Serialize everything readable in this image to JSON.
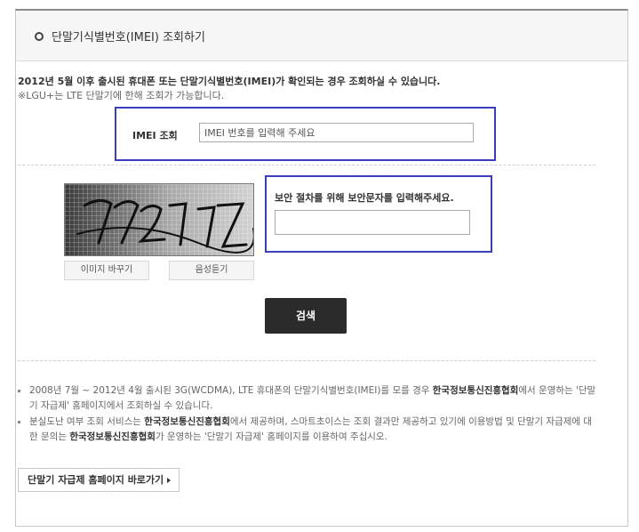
{
  "header": {
    "title": "단말기식별번호(IMEI) 조회하기",
    "bullet_icon": "circle-bullet-icon"
  },
  "intro": {
    "main": "2012년 5월 이후 출시된 휴대폰 또는 단말기식별번호(IMEI)가 확인되는 경우 조회하실 수 있습니다.",
    "sub": "※LGU+는 LTE 단말기에 한해 조회가 가능합니다."
  },
  "imei": {
    "label": "IMEI 조회",
    "placeholder": "IMEI 번호를 입력해 주세요",
    "value": ""
  },
  "captcha": {
    "image_text": "72270Z",
    "refresh_label": "이미지 바꾸기",
    "audio_label": "음성듣기",
    "prompt": "보안 절차를 위해 보안문자를 입력해주세요.",
    "value": ""
  },
  "search": {
    "label": "검색"
  },
  "notes": [
    {
      "before": "2008년 7월 ~ 2012년 4월 출시된 3G(WCDMA), LTE 휴대폰의 단말기식별번호(IMEI)를 모를 경우 ",
      "bold": "한국정보통신진흥협회",
      "after": "에서 운영하는 '단말기 자급제' 홈페이지에서 조회하실 수 있습니다."
    },
    {
      "before": "분실도난 여부 조회 서비스는 ",
      "bold": "한국정보통신진흥협회",
      "after": "에서 제공하며, 스마트초이스는 조회 결과만 제공하고 있기에 이용방법 및 단말기 자급제에 대한 문의는 ",
      "bold2": "한국정보통신진흥협회",
      "after2": "가 운영하는 '단말기 자급제' 홈페이지를 이용하여 주십시오."
    }
  ],
  "link": {
    "label": "단말기 자급제 홈페이지 바로가기",
    "arrow_icon": "chevron-right-icon"
  },
  "colors": {
    "highlight_border": "#3b3ebc",
    "search_button_bg": "#2b2b2b"
  }
}
